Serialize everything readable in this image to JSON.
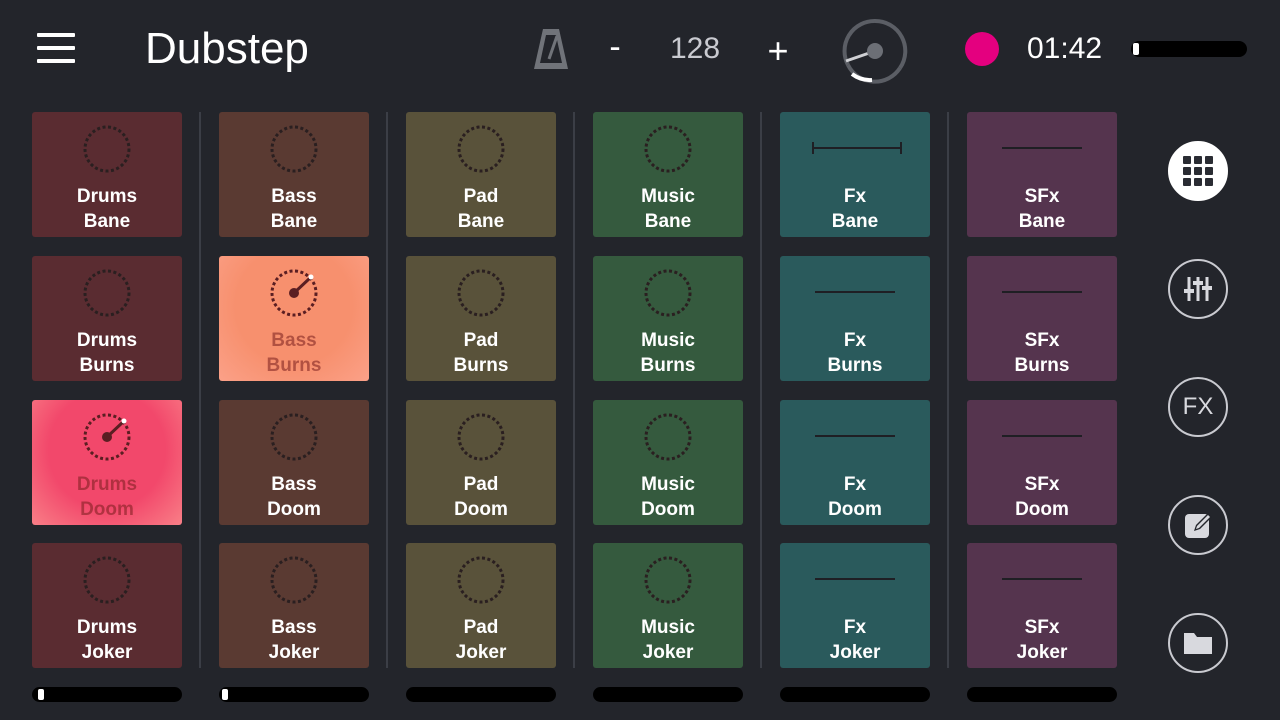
{
  "header": {
    "title": "Dubstep",
    "tempo_minus": "-",
    "tempo_value": "128",
    "tempo_plus": "+",
    "time": "01:42",
    "record_color": "#e4007f",
    "master_volume_level": 0.02
  },
  "columns": [
    {
      "name": "Drums",
      "color": "#5a2c31",
      "volume_level": 0.02,
      "pads": [
        {
          "label1": "Drums",
          "label2": "Bane",
          "icon": "ring-icon"
        },
        {
          "label1": "Drums",
          "label2": "Burns",
          "icon": "ring-icon"
        },
        {
          "label1": "Drums",
          "label2": "Doom",
          "icon": "dial-icon",
          "active": true,
          "active_color": "#f2486b"
        },
        {
          "label1": "Drums",
          "label2": "Joker",
          "icon": "ring-icon"
        }
      ]
    },
    {
      "name": "Bass",
      "color": "#5a3a32",
      "volume_level": 0.0,
      "pads": [
        {
          "label1": "Bass",
          "label2": "Bane",
          "icon": "ring-icon"
        },
        {
          "label1": "Bass",
          "label2": "Burns",
          "icon": "dial-icon",
          "active": true,
          "active_color": "#f7906e"
        },
        {
          "label1": "Bass",
          "label2": "Doom",
          "icon": "ring-icon"
        },
        {
          "label1": "Bass",
          "label2": "Joker",
          "icon": "ring-icon"
        }
      ]
    },
    {
      "name": "Pad",
      "color": "#59523a",
      "pads": [
        {
          "label1": "Pad",
          "label2": "Bane",
          "icon": "ring-icon"
        },
        {
          "label1": "Pad",
          "label2": "Burns",
          "icon": "ring-icon"
        },
        {
          "label1": "Pad",
          "label2": "Doom",
          "icon": "ring-icon"
        },
        {
          "label1": "Pad",
          "label2": "Joker",
          "icon": "ring-icon"
        }
      ]
    },
    {
      "name": "Music",
      "color": "#355a3e",
      "pads": [
        {
          "label1": "Music",
          "label2": "Bane",
          "icon": "ring-icon"
        },
        {
          "label1": "Music",
          "label2": "Burns",
          "icon": "ring-icon"
        },
        {
          "label1": "Music",
          "label2": "Doom",
          "icon": "ring-icon"
        },
        {
          "label1": "Music",
          "label2": "Joker",
          "icon": "ring-icon"
        }
      ]
    },
    {
      "name": "Fx",
      "color": "#2a5a5c",
      "pads": [
        {
          "label1": "Fx",
          "label2": "Bane",
          "icon": "bracket-line-icon"
        },
        {
          "label1": "Fx",
          "label2": "Burns",
          "icon": "line-icon"
        },
        {
          "label1": "Fx",
          "label2": "Doom",
          "icon": "line-icon"
        },
        {
          "label1": "Fx",
          "label2": "Joker",
          "icon": "line-icon"
        }
      ]
    },
    {
      "name": "SFx",
      "color": "#55344e",
      "pads": [
        {
          "label1": "SFx",
          "label2": "Bane",
          "icon": "line-icon"
        },
        {
          "label1": "SFx",
          "label2": "Burns",
          "icon": "line-icon"
        },
        {
          "label1": "SFx",
          "label2": "Doom",
          "icon": "line-icon"
        },
        {
          "label1": "SFx",
          "label2": "Joker",
          "icon": "line-icon"
        }
      ]
    }
  ],
  "sidebar": {
    "buttons": [
      {
        "name": "grid-view",
        "icon": "grid-icon",
        "active": true
      },
      {
        "name": "mixer",
        "icon": "sliders-icon"
      },
      {
        "name": "effects",
        "icon": "fx-icon",
        "text": "FX"
      },
      {
        "name": "edit",
        "icon": "edit-icon"
      },
      {
        "name": "files",
        "icon": "folder-icon"
      }
    ]
  }
}
